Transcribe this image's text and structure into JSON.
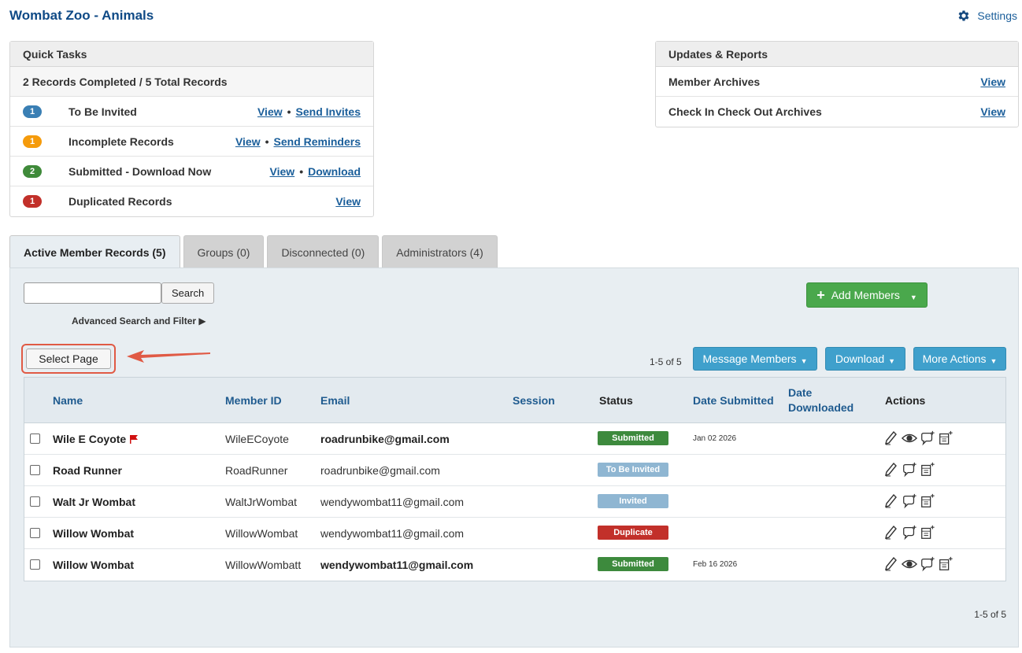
{
  "header": {
    "title": "Wombat Zoo - Animals",
    "settings_label": "Settings"
  },
  "quick_tasks": {
    "title": "Quick Tasks",
    "summary": "2 Records Completed / 5 Total Records",
    "tasks": [
      {
        "count": "1",
        "color": "#3a7fb4",
        "label": "To Be Invited",
        "links": [
          "View",
          "Send Invites"
        ]
      },
      {
        "count": "1",
        "color": "#f59b0c",
        "label": "Incomplete Records",
        "links": [
          "View",
          "Send Reminders"
        ]
      },
      {
        "count": "2",
        "color": "#3f8a3a",
        "label": "Submitted - Download Now",
        "links": [
          "View",
          "Download"
        ]
      },
      {
        "count": "1",
        "color": "#c2302a",
        "label": "Duplicated Records",
        "links": [
          "View"
        ]
      }
    ]
  },
  "updates": {
    "title": "Updates & Reports",
    "rows": [
      {
        "label": "Member Archives",
        "link": "View"
      },
      {
        "label": "Check In Check Out Archives",
        "link": "View"
      }
    ]
  },
  "tabs": [
    {
      "label": "Active Member Records (5)",
      "active": true
    },
    {
      "label": "Groups (0)",
      "active": false
    },
    {
      "label": "Disconnected (0)",
      "active": false
    },
    {
      "label": "Administrators (4)",
      "active": false
    }
  ],
  "toolbar": {
    "search_value": "",
    "search_button": "Search",
    "advanced": "Advanced Search and Filter ▶",
    "add_members": "Add Members",
    "select_page": "Select Page",
    "count": "1-5 of 5",
    "message_members": "Message Members",
    "download": "Download",
    "more_actions": "More Actions"
  },
  "table": {
    "headers": {
      "name": "Name",
      "member_id": "Member ID",
      "email": "Email",
      "session": "Session",
      "status": "Status",
      "date_submitted": "Date Submitted",
      "date_downloaded_1": "Date",
      "date_downloaded_2": "Downloaded",
      "actions": "Actions"
    },
    "rows": [
      {
        "name": "Wile E Coyote",
        "flag": true,
        "member_id": "WileECoyote",
        "email": "roadrunbike@gmail.com",
        "email_bold": true,
        "status": "Submitted",
        "status_color": "#3d8a3d",
        "date_submitted": "Jan 02 2026",
        "has_view": true
      },
      {
        "name": "Road Runner",
        "flag": false,
        "member_id": "RoadRunner",
        "email": "roadrunbike@gmail.com",
        "email_bold": false,
        "status": "To Be Invited",
        "status_color": "#8fb6d2",
        "date_submitted": "",
        "has_view": false
      },
      {
        "name": "Walt Jr Wombat",
        "flag": false,
        "member_id": "WaltJrWombat",
        "email": "wendywombat11@gmail.com",
        "email_bold": false,
        "status": "Invited",
        "status_color": "#8fb6d2",
        "date_submitted": "",
        "has_view": false
      },
      {
        "name": "Willow Wombat",
        "flag": false,
        "member_id": "WillowWombat",
        "email": "wendywombat11@gmail.com",
        "email_bold": false,
        "status": "Duplicate",
        "status_color": "#c2302a",
        "date_submitted": "",
        "has_view": false
      },
      {
        "name": "Willow Wombat",
        "flag": false,
        "member_id": "WillowWombatt",
        "email": "wendywombat11@gmail.com",
        "email_bold": true,
        "status": "Submitted",
        "status_color": "#3d8a3d",
        "date_submitted": "Feb 16 2026",
        "has_view": true
      }
    ]
  },
  "footer": {
    "count": "1-5 of 5"
  }
}
